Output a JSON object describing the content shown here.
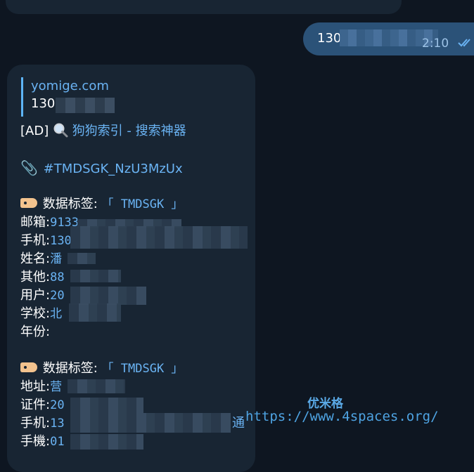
{
  "previous_message": {
    "text": "🔥 ████ 🔥"
  },
  "outgoing_message": {
    "text": "130",
    "time": "2:10",
    "status_icon": "double-check-icon"
  },
  "incoming_message": {
    "quote": {
      "title": "yomige.com",
      "subtitle": "1307"
    },
    "ad": {
      "prefix": "[AD]",
      "icon": "magnifier-icon",
      "link": "狗狗索引 - 搜索神器"
    },
    "hashtag": {
      "icon": "paperclip-icon",
      "text": "#TMDSGK_NzU3MzUx"
    },
    "sections": [
      {
        "tag_icon": "label-tag-icon",
        "title": "数据标签:",
        "tag_value": "「 TMDSGK 」",
        "fields": [
          {
            "label": "邮箱:",
            "value": "9133"
          },
          {
            "label": "手机:",
            "value": "130"
          },
          {
            "label": "姓名:",
            "value": "潘"
          },
          {
            "label": "其他:",
            "value": "88"
          },
          {
            "label": "用户:",
            "value": "20"
          },
          {
            "label": "学校:",
            "value": "北"
          },
          {
            "label": "年份:",
            "value": ""
          }
        ]
      },
      {
        "tag_icon": "label-tag-icon",
        "title": "数据标签:",
        "tag_value": "「 TMDSGK 」",
        "fields": [
          {
            "label": "地址:",
            "value": "营"
          },
          {
            "label": "证件:",
            "value": "20"
          },
          {
            "label": "手机:",
            "value": "13",
            "suffix": "通"
          },
          {
            "label": "手機:",
            "value": "01"
          }
        ]
      }
    ]
  },
  "watermark": {
    "name": "优米格",
    "url": "https://www.4spaces.org/"
  }
}
